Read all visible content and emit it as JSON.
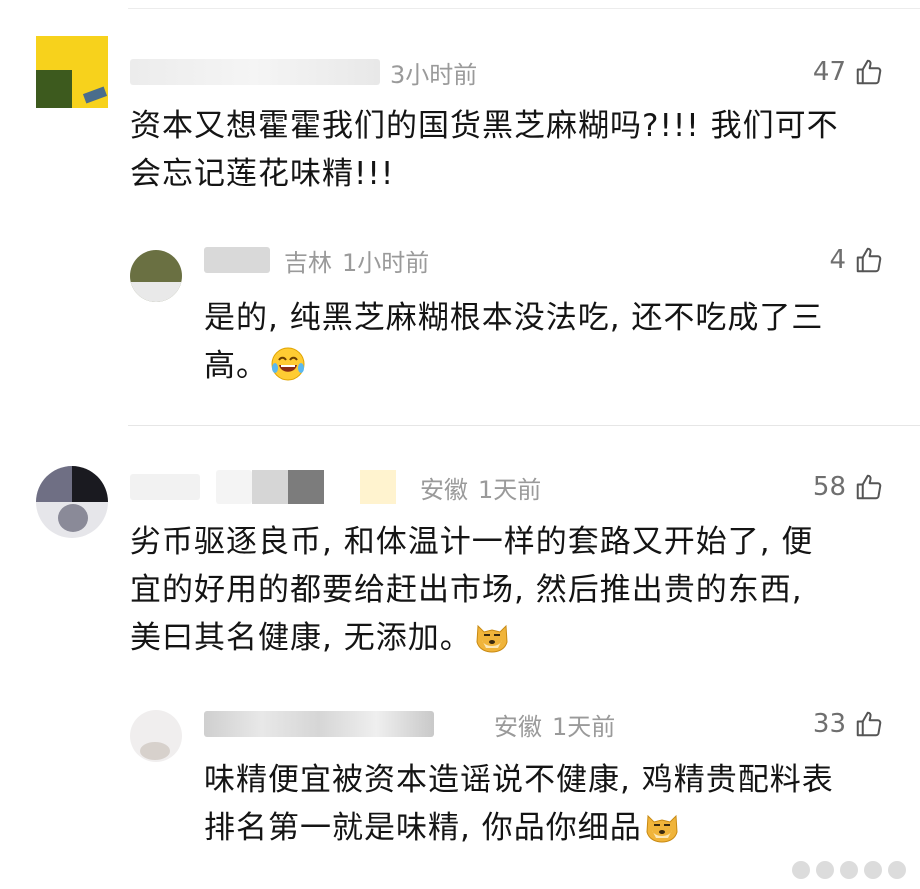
{
  "comments": [
    {
      "meta": {
        "username": "",
        "location": "",
        "time": "3小时前"
      },
      "likes": "47",
      "text_lines": [
        "资本又想霍霍我们的国货黑芝麻糊吗?!!! 我们可不",
        "会忘记莲花味精!!!"
      ],
      "reply": {
        "meta": {
          "username": "",
          "location": "吉林",
          "time": "1小时前"
        },
        "likes": "4",
        "text_lines": [
          "是的, 纯黑芝麻糊根本没法吃, 还不吃成了三",
          "高。"
        ],
        "emoji": "tears-of-joy-emoji"
      }
    },
    {
      "meta": {
        "username": "",
        "location": "安徽",
        "time": "1天前"
      },
      "likes": "58",
      "text_lines": [
        "劣币驱逐良币, 和体温计一样的套路又开始了, 便",
        "宜的好用的都要给赶出市场, 然后推出贵的东西,",
        "美曰其名健康, 无添加。"
      ],
      "emoji": "doge-emoji",
      "reply": {
        "meta": {
          "username": "",
          "location": "安徽",
          "time": "1天前"
        },
        "likes": "33",
        "text_lines": [
          "味精便宜被资本造谣说不健康, 鸡精贵配料表",
          "排名第一就是味精, 你品你细品"
        ],
        "emoji": "doge-emoji"
      }
    }
  ],
  "icons": {
    "like": "thumbs-up-icon"
  },
  "colors": {
    "meta": "#9a9a9a",
    "text": "#141414",
    "count": "#6f6f6f"
  }
}
